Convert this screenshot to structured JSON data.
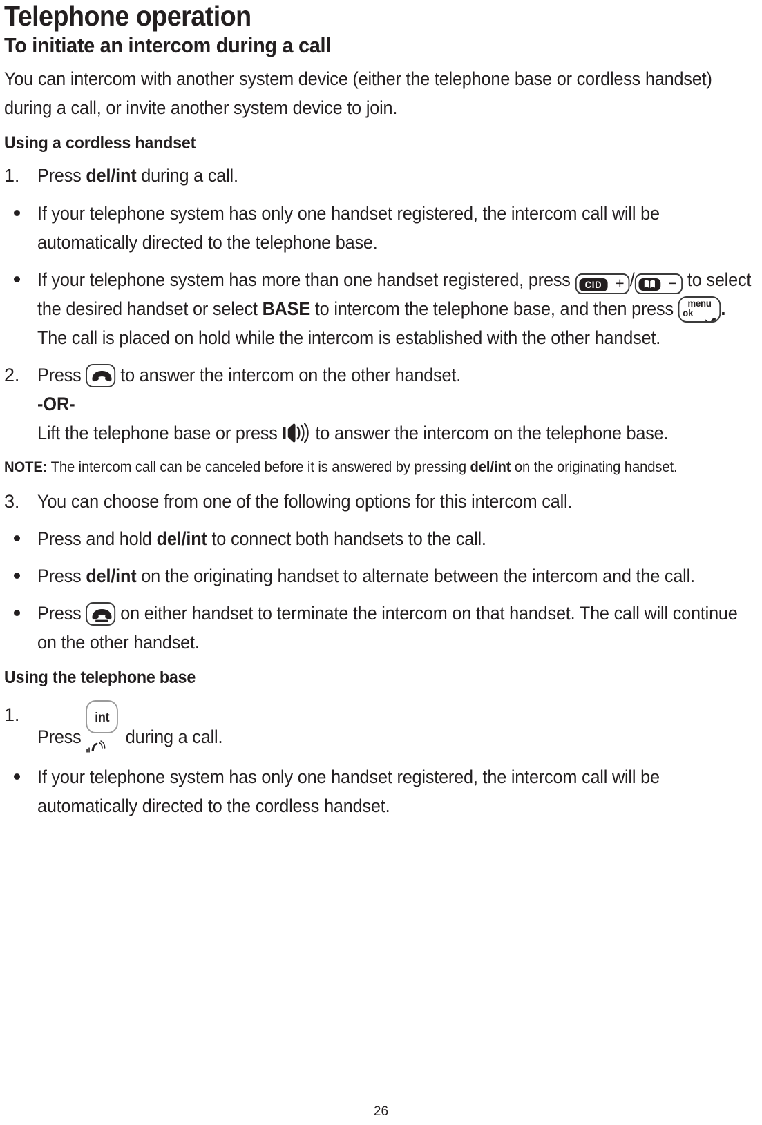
{
  "page": {
    "title": "Telephone operation",
    "subtitle": "To initiate an intercom during a call",
    "intro": "You can intercom with another system device (either the telephone base or cordless handset) during a call, or invite another system device to join.",
    "page_number": "26"
  },
  "section_handset": {
    "heading": "Using a cordless handset",
    "step1": {
      "num": "1.",
      "pre": "Press ",
      "key": "del/int",
      "post": " during a call."
    },
    "bullet1": "If your telephone system has only one handset registered, the intercom call will be automatically directed to the telephone base.",
    "bullet2": {
      "p1": "If your telephone system has more than one handset registered, press ",
      "key_cid_label": "CID",
      "key_cid_sign": "+",
      "separator": "/",
      "key_book_label": "book-icon",
      "key_book_sign": "−",
      "p2": " to select the desired handset or select ",
      "base_bold": "BASE",
      "p3": " to intercom the telephone base, and then press ",
      "key_menu_l1": "menu",
      "key_menu_l2": "ok",
      "key_menu_icon": "mute-microphone-icon",
      "p4": ".",
      "p5": "The call is placed on hold while the intercom is established with the other handset."
    },
    "step2": {
      "num": "2.",
      "pre": "Press ",
      "key_icon": "handset-talk-icon",
      "post": " to answer the intercom on the other handset.",
      "or": "-OR-",
      "alt_pre": "Lift the telephone base or press ",
      "alt_icon": "speakerphone-icon",
      "alt_post": " to answer the intercom on the telephone base."
    },
    "note": {
      "label": "NOTE:",
      "p1": " The intercom call can be canceled before it is answered by pressing ",
      "key": "del/int",
      "p2": " on the originating handset."
    },
    "step3": {
      "num": "3.",
      "text": "You can choose from one of the following options for this intercom call."
    },
    "bullet3": {
      "p1": "Press and hold ",
      "key": "del/int",
      "p2": " to connect both handsets to the call."
    },
    "bullet4": {
      "p1": "Press ",
      "key": "del/int",
      "p2": " on the originating handset to alternate between the intercom and the call."
    },
    "bullet5": {
      "p1": "Press ",
      "key_icon": "handset-end-icon",
      "p2": " on either handset to terminate the intercom on that handset. The call will continue on the other handset."
    }
  },
  "section_base": {
    "heading": "Using the telephone base",
    "step1": {
      "num": "1.",
      "pre": "Press ",
      "key_label": "int",
      "key_icon": "intercom-waves-icon",
      "post": " during a call."
    },
    "bullet1": "If your telephone system has only one handset registered, the intercom call will be automatically directed to the cordless handset."
  },
  "colors": {
    "text": "#231f20",
    "key_border": "#3b3b3b",
    "key_cap_bg": "#231f20",
    "key_cap_text": "#ffffff"
  }
}
